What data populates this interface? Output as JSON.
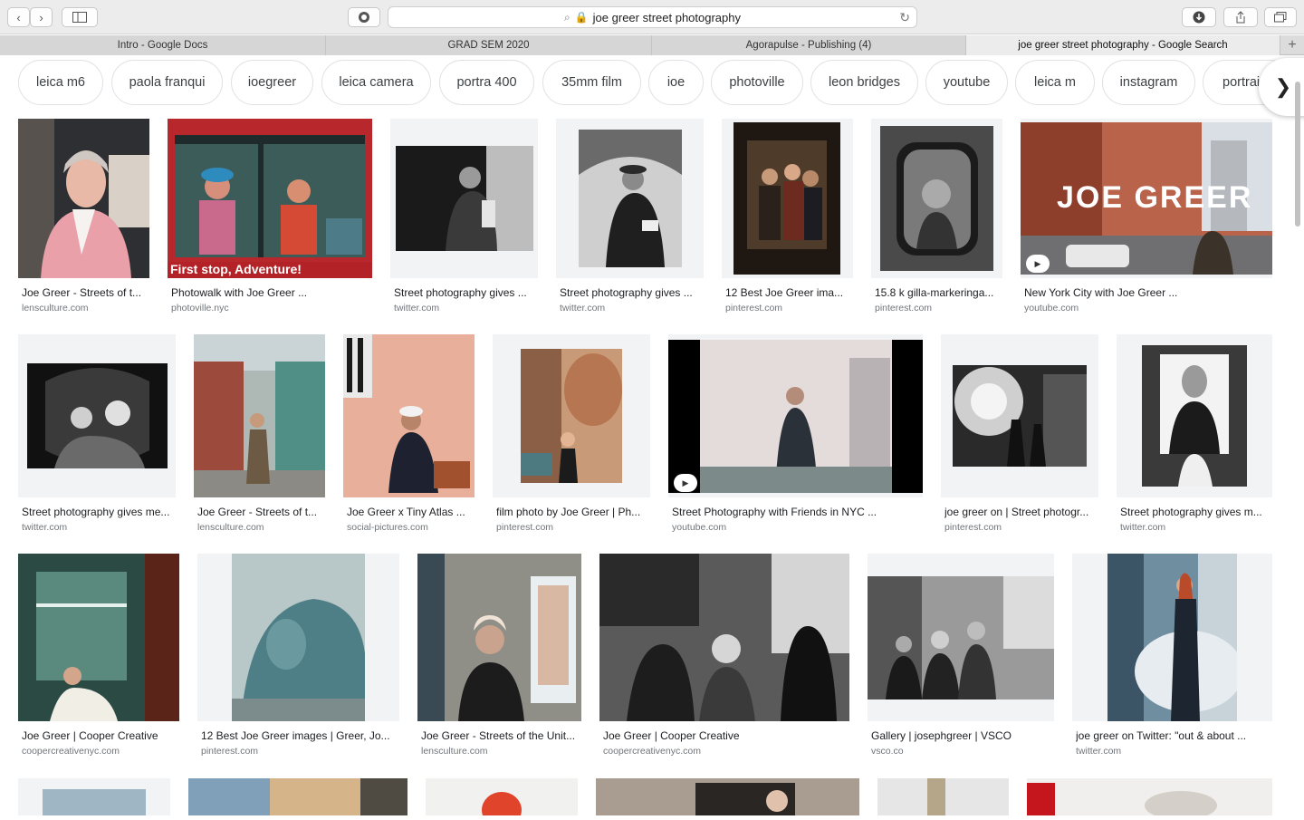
{
  "toolbar": {
    "url_text": "joe greer street photography",
    "icons": {
      "back": "chevron-left",
      "forward": "chevron-right",
      "sidebar": "sidebar",
      "extension": "grammarly",
      "search": "magnifier",
      "lock": "lock",
      "reload": "reload",
      "download": "download",
      "share": "share",
      "tabs": "tab-overview"
    }
  },
  "tabs": [
    {
      "label": "Intro - Google Docs"
    },
    {
      "label": "GRAD SEM 2020"
    },
    {
      "label": "Agorapulse - Publishing (4)"
    },
    {
      "label": "joe greer street photography - Google Search"
    }
  ],
  "chips": [
    "leica m6",
    "paola franqui",
    "ioegreer",
    "leica camera",
    "portra 400",
    "35mm film",
    "ioe",
    "photoville",
    "leon bridges",
    "youtube",
    "leica m",
    "instagram",
    "portrai"
  ],
  "results": {
    "row1": [
      {
        "caption": "Joe Greer - Streets of t...",
        "domain": "lensculture.com"
      },
      {
        "caption": "Photowalk with Joe Greer ...",
        "domain": "photoville.nyc",
        "banner": "First stop, Adventure!"
      },
      {
        "caption": "Street photography gives ...",
        "domain": "twitter.com"
      },
      {
        "caption": "Street photography gives ...",
        "domain": "twitter.com"
      },
      {
        "caption": "12 Best Joe Greer ima...",
        "domain": "pinterest.com"
      },
      {
        "caption": "15.8 k gilla-markeringa...",
        "domain": "pinterest.com"
      },
      {
        "caption": "New York City with Joe Greer ...",
        "domain": "youtube.com",
        "overlay": "JOE GREER"
      }
    ],
    "row2": [
      {
        "caption": "Street photography gives me...",
        "domain": "twitter.com"
      },
      {
        "caption": "Joe Greer - Streets of t...",
        "domain": "lensculture.com"
      },
      {
        "caption": "Joe Greer x Tiny Atlas ...",
        "domain": "social-pictures.com"
      },
      {
        "caption": "film photo by Joe Greer | Ph...",
        "domain": "pinterest.com"
      },
      {
        "caption": "Street Photography with Friends in NYC ...",
        "domain": "youtube.com"
      },
      {
        "caption": "joe greer on | Street photogr...",
        "domain": "pinterest.com"
      },
      {
        "caption": "Street photography gives m...",
        "domain": "twitter.com"
      }
    ],
    "row3": [
      {
        "caption": "Joe Greer | Cooper Creative",
        "domain": "coopercreativenyc.com"
      },
      {
        "caption": "12 Best Joe Greer images | Greer, Jo...",
        "domain": "pinterest.com"
      },
      {
        "caption": "Joe Greer - Streets of the Unit...",
        "domain": "lensculture.com"
      },
      {
        "caption": "Joe Greer | Cooper Creative",
        "domain": "coopercreativenyc.com"
      },
      {
        "caption": "Gallery | josephgreer | VSCO",
        "domain": "vsco.co"
      },
      {
        "caption": "joe greer on Twitter: \"out & about ...",
        "domain": "twitter.com"
      }
    ]
  }
}
